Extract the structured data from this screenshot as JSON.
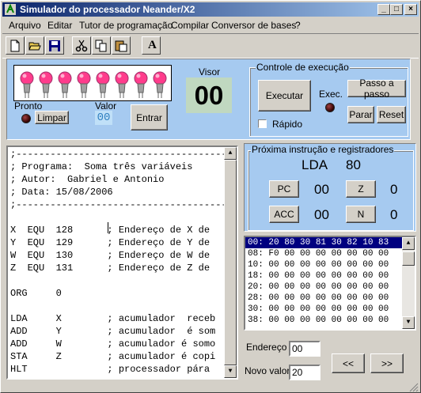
{
  "window": {
    "title": "Simulador do processador Neander/X2"
  },
  "menu": [
    "Arquivo",
    "Editar",
    "Tutor de programação",
    "Compilar",
    "Conversor de bases",
    "?"
  ],
  "toolbar": {
    "icons": [
      "new-icon",
      "open-icon",
      "save-icon",
      "cut-icon",
      "copy-icon",
      "paste-icon",
      "font-icon"
    ],
    "font_label": "A"
  },
  "io": {
    "pronto_label": "Pronto",
    "limpar_label": "Limpar",
    "valor_label": "Valor",
    "valor_value": "00",
    "entrar_label": "Entrar",
    "visor_label": "Visor",
    "visor_value": "00",
    "leds": 8
  },
  "control": {
    "title": "Controle de execução",
    "executar_label": "Executar",
    "exec_label": "Exec.",
    "passo_label": "Passo a passo",
    "parar_label": "Parar",
    "reset_label": "Reset",
    "rapido_label": "Rápido"
  },
  "registers": {
    "title": "Próxima instrução e registradores",
    "instr": "LDA",
    "instr_arg": "80",
    "pc_label": "PC",
    "pc_value": "00",
    "z_label": "Z",
    "z_value": "0",
    "acc_label": "ACC",
    "acc_value": "00",
    "n_label": "N",
    "n_value": "0"
  },
  "code_lines": [
    ";---------------------------------------",
    "; Programa:  Soma três variáveis",
    "; Autor:  Gabriel e Antonio",
    "; Data: 15/08/2006",
    ";---------------------------------------",
    "",
    "X  EQU  128      ; Endereço de X de",
    "Y  EQU  129      ; Endereço de Y de",
    "W  EQU  130      ; Endereço de W de",
    "Z  EQU  131      ; Endereço de Z de",
    "",
    "ORG     0",
    "",
    "LDA     X        ; acumulador  receb",
    "ADD     Y        ; acumulador  é som",
    "ADD     W        ; acumulador é somo",
    "STA     Z        ; acumulador é copi",
    "HLT              ; processador pára"
  ],
  "memory_rows": [
    "00: 20 80 30 81 30 82 10 83",
    "08: F0 00 00 00 00 00 00 00",
    "10: 00 00 00 00 00 00 00 00",
    "18: 00 00 00 00 00 00 00 00",
    "20: 00 00 00 00 00 00 00 00",
    "28: 00 00 00 00 00 00 00 00",
    "30: 00 00 00 00 00 00 00 00",
    "38: 00 00 00 00 00 00 00 00"
  ],
  "nav": {
    "endereco_label": "Endereço",
    "endereco_value": "00",
    "novo_valor_label": "Novo valor",
    "novo_valor_value": "20",
    "prev_label": "<<",
    "next_label": ">>"
  },
  "colors": {
    "panel": "#a6caf0",
    "visor_bg": "#c0d8c0",
    "led_on": "#ff3c8c"
  }
}
